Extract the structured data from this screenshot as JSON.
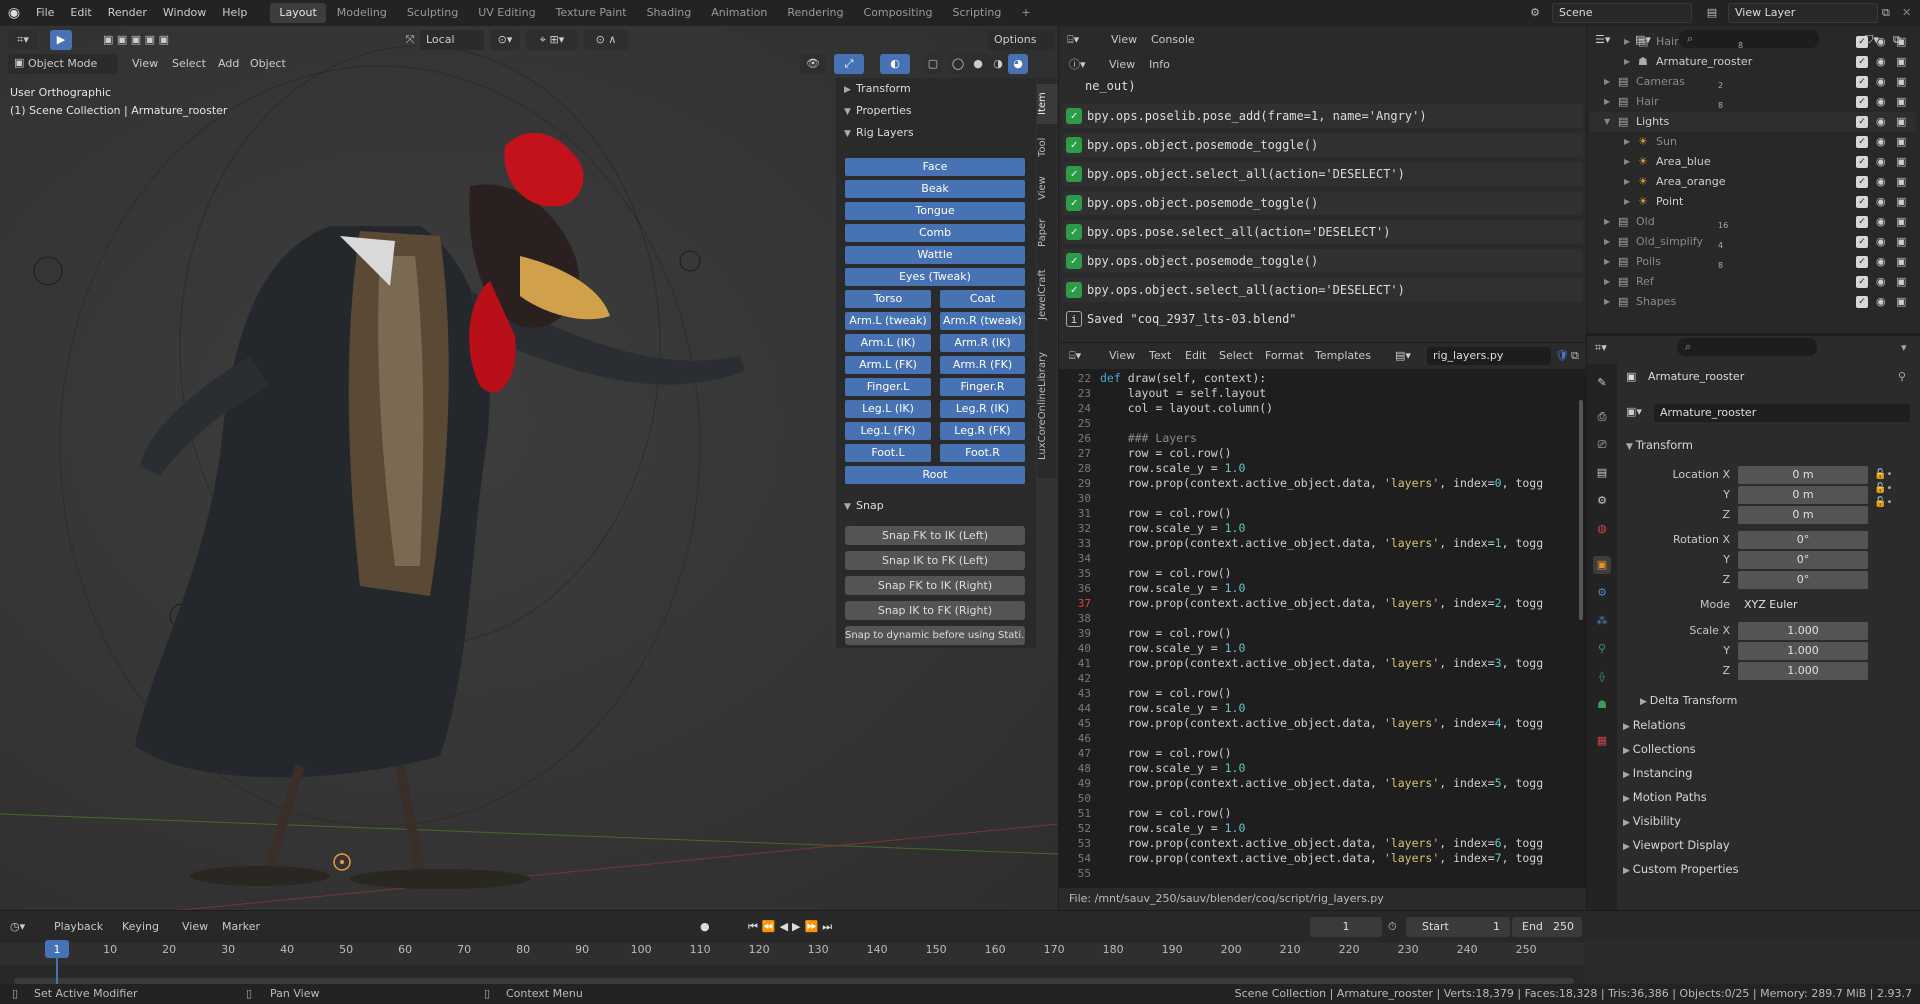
{
  "topbar": {
    "menus": [
      "File",
      "Edit",
      "Render",
      "Window",
      "Help"
    ],
    "workspaces": [
      "Layout",
      "Modeling",
      "Sculpting",
      "UV Editing",
      "Texture Paint",
      "Shading",
      "Animation",
      "Rendering",
      "Compositing",
      "Scripting"
    ],
    "active_workspace": "Layout",
    "add_tab": "+",
    "scene": "Scene",
    "view_layer": "View Layer"
  },
  "viewport": {
    "mode": "Object Mode",
    "menus": [
      "View",
      "Select",
      "Add",
      "Object"
    ],
    "orientation": "Local",
    "options": "Options",
    "view_label": "User Orthographic",
    "collection_label": "(1) Scene Collection | Armature_rooster"
  },
  "npanel": {
    "transform": "Transform",
    "properties": "Properties",
    "rig_layers": "Rig Layers",
    "snap": "Snap",
    "rig_buttons_full": [
      "Face",
      "Beak",
      "Tongue",
      "Comb",
      "Wattle",
      "Eyes (Tweak)"
    ],
    "rig_buttons_pairs": [
      [
        "Torso",
        "Coat"
      ],
      [
        "Arm.L (tweak)",
        "Arm.R (tweak)"
      ],
      [
        "Arm.L (IK)",
        "Arm.R (IK)"
      ],
      [
        "Arm.L (FK)",
        "Arm.R (FK)"
      ],
      [
        "Finger.L",
        "Finger.R"
      ],
      [
        "Leg.L (IK)",
        "Leg.R (IK)"
      ],
      [
        "Leg.L (FK)",
        "Leg.R (FK)"
      ],
      [
        "Foot.L",
        "Foot.R"
      ]
    ],
    "root": "Root",
    "snap_buttons": [
      "Snap FK to IK (Left)",
      "Snap IK to FK (Left)",
      "Snap FK to IK (Right)",
      "Snap IK to FK (Right)",
      "Snap to dynamic before using Stati..."
    ],
    "tabs": [
      "Item",
      "Tool",
      "View",
      "Paper",
      "JewelCraft",
      "LuxCoreOnlineLibrary"
    ]
  },
  "info": {
    "header": [
      "View",
      "Console"
    ],
    "subheader": [
      "View",
      "Info"
    ],
    "partial_line": "ne_out)",
    "lines": [
      "bpy.ops.poselib.pose_add(frame=1, name='Angry')",
      "bpy.ops.object.posemode_toggle()",
      "bpy.ops.object.select_all(action='DESELECT')",
      "bpy.ops.object.posemode_toggle()",
      "bpy.ops.pose.select_all(action='DESELECT')",
      "bpy.ops.object.posemode_toggle()",
      "bpy.ops.object.select_all(action='DESELECT')"
    ],
    "saved": "Saved \"coq_2937_lts-03.blend\""
  },
  "texteditor": {
    "menus": [
      "View",
      "Text",
      "Edit",
      "Select",
      "Format",
      "Templates"
    ],
    "filename": "rig_layers.py",
    "footer": "File: /mnt/sauv_250/sauv/blender/coq/script/rig_layers.py",
    "line_numbers": [
      "22",
      "23",
      "24",
      "25",
      "26",
      "27",
      "28",
      "29",
      "30",
      "31",
      "32",
      "33",
      "34",
      "35",
      "36",
      "37",
      "38",
      "39",
      "40",
      "41",
      "42",
      "43",
      "44",
      "45",
      "46",
      "47",
      "48",
      "49",
      "50",
      "51",
      "52",
      "53",
      "54",
      "55"
    ],
    "current_line": "37"
  },
  "outliner": {
    "rows": [
      {
        "name": "Hair",
        "count": "8",
        "dim": true
      },
      {
        "name": "Armature_rooster",
        "dim": false
      },
      {
        "name": "Cameras",
        "count": "2",
        "dim": true
      },
      {
        "name": "Hair",
        "count": "8",
        "dim": true
      },
      {
        "name": "Lights",
        "dim": false
      },
      {
        "name": "Sun",
        "dim": true
      },
      {
        "name": "Area_blue",
        "dim": false
      },
      {
        "name": "Area_orange",
        "dim": false
      },
      {
        "name": "Point",
        "dim": false
      },
      {
        "name": "Old",
        "count": "16",
        "dim": true
      },
      {
        "name": "Old_simplify",
        "count": "4",
        "dim": true
      },
      {
        "name": "Poils",
        "count": "8",
        "dim": true
      },
      {
        "name": "Ref",
        "dim": true
      },
      {
        "name": "Shapes",
        "dim": true
      }
    ]
  },
  "properties": {
    "object_name": "Armature_rooster",
    "data_name": "Armature_rooster",
    "transform": "Transform",
    "location_x_label": "Location X",
    "y_label": "Y",
    "z_label": "Z",
    "rotation_x_label": "Rotation X",
    "mode_label": "Mode",
    "scale_x_label": "Scale X",
    "location": [
      "0 m",
      "0 m",
      "0 m"
    ],
    "rotation": [
      "0°",
      "0°",
      "0°"
    ],
    "mode": "XYZ Euler",
    "scale": [
      "1.000",
      "1.000",
      "1.000"
    ],
    "delta": "Delta Transform",
    "sections": [
      "Relations",
      "Collections",
      "Instancing",
      "Motion Paths",
      "Visibility",
      "Viewport Display",
      "Custom Properties"
    ]
  },
  "timeline": {
    "menus": [
      "Playback",
      "Keying",
      "View",
      "Marker"
    ],
    "current_frame": "1",
    "start_label": "Start",
    "start": "1",
    "end_label": "End",
    "end": "250",
    "ticks": [
      "1",
      "10",
      "20",
      "30",
      "40",
      "50",
      "60",
      "70",
      "80",
      "90",
      "100",
      "110",
      "120",
      "130",
      "140",
      "150",
      "160",
      "170",
      "180",
      "190",
      "200",
      "210",
      "220",
      "230",
      "240",
      "250"
    ]
  },
  "status": {
    "left": "Set Active Modifier",
    "mid": "Pan View",
    "right_menu": "Context Menu",
    "stats": "Scene Collection | Armature_rooster | Verts:18,379 | Faces:18,328 | Tris:36,386 | Objects:0/25 | Memory: 289.7 MiB | 2.93.7"
  }
}
